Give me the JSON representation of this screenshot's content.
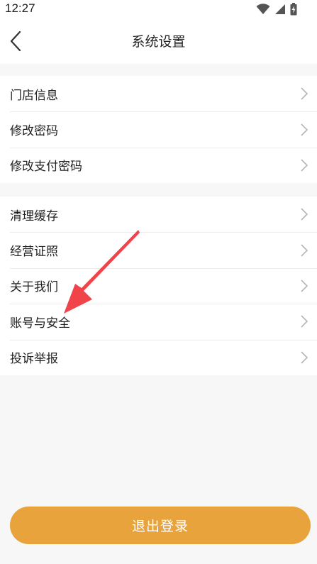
{
  "status_bar": {
    "time": "12:27",
    "icons": [
      "wifi-icon",
      "signal-icon",
      "battery-charging-icon"
    ]
  },
  "header": {
    "title": "系统设置",
    "back_icon": "chevron-left-icon"
  },
  "groups": [
    {
      "items": [
        {
          "label": "门店信息"
        },
        {
          "label": "修改密码"
        },
        {
          "label": "修改支付密码"
        }
      ]
    },
    {
      "items": [
        {
          "label": "清理缓存"
        },
        {
          "label": "经营证照"
        },
        {
          "label": "关于我们"
        },
        {
          "label": "账号与安全"
        },
        {
          "label": "投诉举报"
        }
      ]
    }
  ],
  "logout": {
    "label": "退出登录"
  },
  "colors": {
    "accent": "#e8a33c",
    "annotation": "#f0434a",
    "background": "#f7f7f7"
  }
}
